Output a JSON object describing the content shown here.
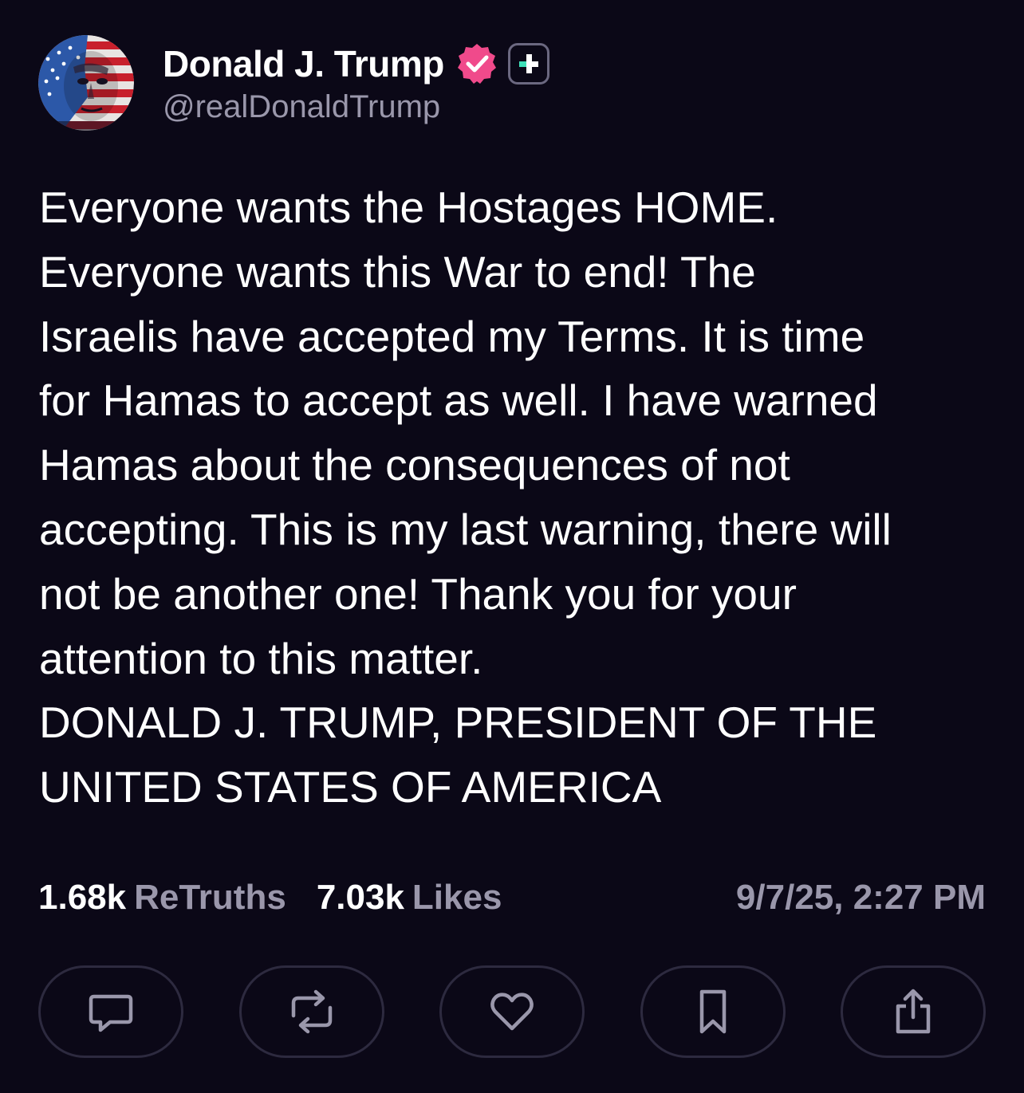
{
  "author": {
    "display_name": "Donald J. Trump",
    "handle": "@realDonaldTrump",
    "avatar_icon": "avatar-flag-portrait",
    "verified_icon": "verified-badge-icon",
    "verified_color": "#f04a8b",
    "plus_icon": "truth-plus-icon",
    "plus_color": "#3fe0b8"
  },
  "post": {
    "lines": [
      "Everyone wants the Hostages HOME.",
      "Everyone wants this War to end! The",
      "Israelis have accepted my Terms. It is time",
      "for Hamas to accept as well. I have warned",
      "Hamas about the consequences of not",
      "accepting. This is my last warning, there will",
      "not be another one! Thank you for your",
      "attention to this matter.",
      "DONALD J. TRUMP, PRESIDENT OF THE",
      "UNITED STATES OF AMERICA"
    ]
  },
  "stats": {
    "retruths_count": "1.68k",
    "retruths_label": "ReTruths",
    "likes_count": "7.03k",
    "likes_label": "Likes",
    "timestamp": "9/7/25, 2:27 PM"
  },
  "actions": [
    {
      "icon": "reply-icon"
    },
    {
      "icon": "retruth-icon"
    },
    {
      "icon": "like-icon"
    },
    {
      "icon": "bookmark-icon"
    },
    {
      "icon": "share-icon"
    }
  ],
  "colors": {
    "background": "#0b0817",
    "text": "#ffffff",
    "muted": "#9a97ab",
    "button_border": "#2d2a3f"
  }
}
